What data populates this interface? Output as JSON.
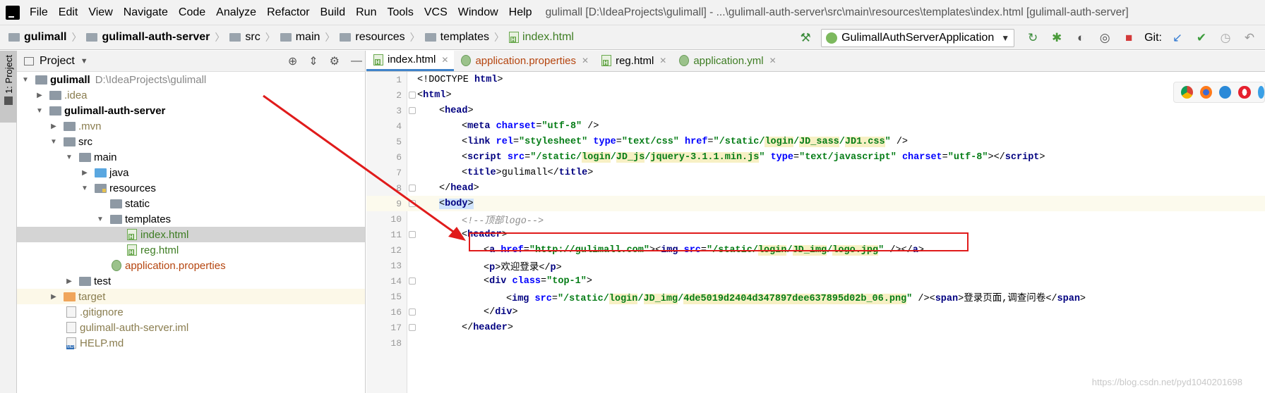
{
  "menubar": {
    "items": [
      "File",
      "Edit",
      "View",
      "Navigate",
      "Code",
      "Analyze",
      "Refactor",
      "Build",
      "Run",
      "Tools",
      "VCS",
      "Window",
      "Help"
    ],
    "title": "gulimall [D:\\IdeaProjects\\gulimall] - ...\\gulimall-auth-server\\src\\main\\resources\\templates\\index.html [gulimall-auth-server]"
  },
  "navbar": {
    "breadcrumbs": [
      "gulimall",
      "gulimall-auth-server",
      "src",
      "main",
      "resources",
      "templates",
      "index.html"
    ],
    "run_config": "GulimallAuthServerApplication",
    "git_label": "Git:"
  },
  "sidestrip": {
    "label": "1: Project"
  },
  "project": {
    "header": "Project",
    "tree": [
      {
        "name": "gulimall",
        "path": "D:\\IdeaProjects\\gulimall"
      },
      {
        "name": ".idea"
      },
      {
        "name": "gulimall-auth-server"
      },
      {
        "name": ".mvn"
      },
      {
        "name": "src"
      },
      {
        "name": "main"
      },
      {
        "name": "java"
      },
      {
        "name": "resources"
      },
      {
        "name": "static"
      },
      {
        "name": "templates"
      },
      {
        "name": "index.html"
      },
      {
        "name": "reg.html"
      },
      {
        "name": "application.properties"
      },
      {
        "name": "test"
      },
      {
        "name": "target"
      },
      {
        "name": ".gitignore"
      },
      {
        "name": "gulimall-auth-server.iml"
      },
      {
        "name": "HELP.md"
      }
    ]
  },
  "editor": {
    "tabs": [
      "index.html",
      "application.properties",
      "reg.html",
      "application.yml"
    ],
    "line_numbers": [
      "1",
      "2",
      "3",
      "4",
      "5",
      "6",
      "7",
      "8",
      "9",
      "10",
      "11",
      "12",
      "13",
      "14",
      "15",
      "16",
      "17",
      "18"
    ],
    "code": {
      "l1_doctype": "<!DOCTYPE ",
      "l1_html": "html",
      "l1_close": ">",
      "l2": "html",
      "l3": "head",
      "l4_tag": "meta",
      "l4_attr": "charset",
      "l4_val": "\"utf-8\"",
      "l5_tag": "link",
      "l5_a1": "rel",
      "l5_v1": "\"stylesheet\"",
      "l5_a2": "type",
      "l5_v2": "\"text/css\"",
      "l5_a3": "href",
      "l5_v3a": "\"/static/",
      "l5_v3b": "login",
      "l5_v3c": "/",
      "l5_v3d": "JD_sass",
      "l5_v3e": "/",
      "l5_v3f": "JD1.css",
      "l5_v3g": "\"",
      "l6_tag": "script",
      "l6_a1": "src",
      "l6_v1a": "\"/static/",
      "l6_v1b": "login",
      "l6_v1c": "/",
      "l6_v1d": "JD_js",
      "l6_v1e": "/",
      "l6_v1f": "jquery-3.1.1.min.js",
      "l6_v1g": "\"",
      "l6_a2": "type",
      "l6_v2": "\"text/javascript\"",
      "l6_a3": "charset",
      "l6_v3": "\"utf-8\"",
      "l6_close": "script",
      "l7_tag": "title",
      "l7_text": "gulimall",
      "l8": "head",
      "l9": "body",
      "l10": "<!--顶部logo-->",
      "l11": "header",
      "l12_a": "a",
      "l12_attr": "href",
      "l12_val": "\"http://gulimall.com\"",
      "l12_img": "img",
      "l12_src": "src",
      "l12_v1": "\"/static/",
      "l12_v2": "login",
      "l12_v3": "/",
      "l12_v4": "JD_img",
      "l12_v5": "/",
      "l12_v6": "logo.jpg",
      "l12_v7": "\"",
      "l13_tag": "p",
      "l13_text": "欢迎登录",
      "l14_tag": "div",
      "l14_attr": "class",
      "l14_val": "\"top-1\"",
      "l15_tag": "img",
      "l15_attr": "src",
      "l15_v1": "\"/static/",
      "l15_v2": "login",
      "l15_v3": "/",
      "l15_v4": "JD_img",
      "l15_v5": "/",
      "l15_v6": "4de5019d2404d347897dee637895d02b_06.png",
      "l15_v7": "\"",
      "l15_span": "span",
      "l15_text": "登录页面,调查问卷",
      "l16": "div",
      "l17": "header"
    }
  },
  "watermark": "https://blog.csdn.net/pyd1040201698",
  "colors": {
    "annotation_red": "#e01b1b"
  }
}
